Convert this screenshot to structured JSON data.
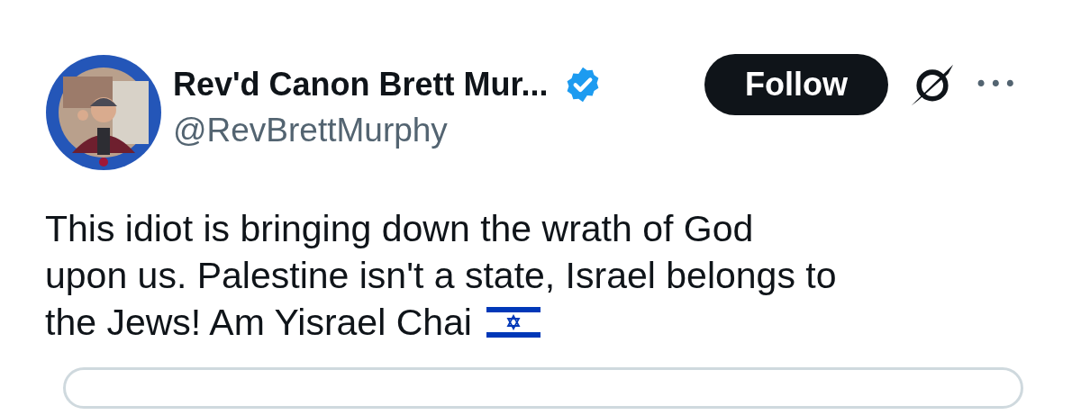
{
  "author": {
    "name": "Rev'd Canon Brett Mur...",
    "verified": true,
    "handle": "@RevBrettMurphy"
  },
  "follow_button": {
    "label": "Follow"
  },
  "more_button": {
    "label": "•••"
  },
  "post": {
    "lines": [
      "This idiot is bringing down the wrath of God",
      "upon us. Palestine isn't a state, Israel belongs to",
      "the Jews! Am Yisrael Chai"
    ]
  }
}
